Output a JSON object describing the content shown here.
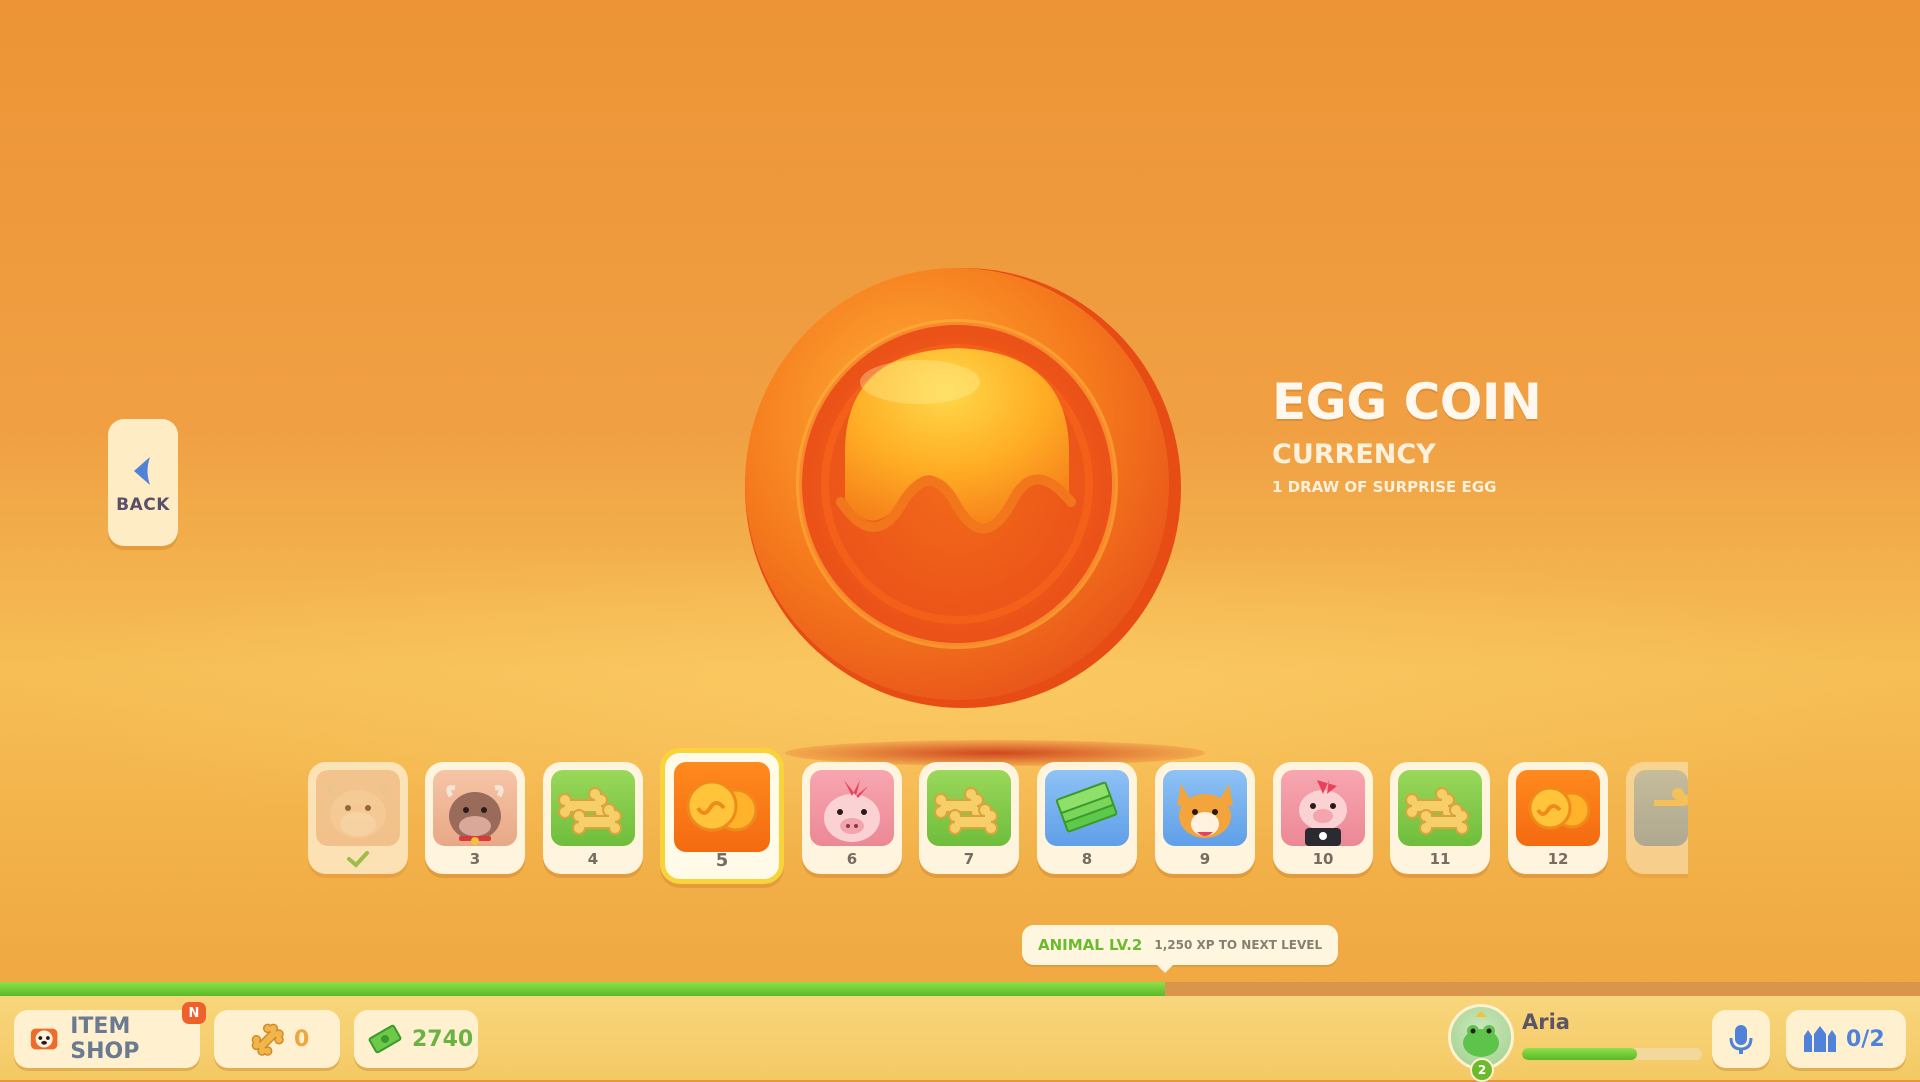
{
  "back_button": {
    "label": "BACK"
  },
  "item": {
    "name": "EGG COIN",
    "type": "CURRENCY",
    "description": "1 DRAW OF SURPRISE EGG"
  },
  "reward_track": {
    "selected_level": 5,
    "slots": [
      {
        "label": "",
        "icon": "cow-icon",
        "claimed": true
      },
      {
        "label": "3",
        "icon": "cow-with-bell-icon"
      },
      {
        "label": "4",
        "icon": "bone-biscuits-icon"
      },
      {
        "label": "5",
        "icon": "egg-coins-icon",
        "selected": true
      },
      {
        "label": "6",
        "icon": "pig-mohawk-icon"
      },
      {
        "label": "7",
        "icon": "bone-biscuits-icon"
      },
      {
        "label": "8",
        "icon": "cash-stack-icon"
      },
      {
        "label": "9",
        "icon": "corgi-icon"
      },
      {
        "label": "10",
        "icon": "punk-pig-icon"
      },
      {
        "label": "11",
        "icon": "bone-biscuits-icon"
      },
      {
        "label": "12",
        "icon": "egg-coins-icon"
      },
      {
        "label": "",
        "icon": "bone-biscuits-icon"
      }
    ]
  },
  "level_tooltip": {
    "level_text": "ANIMAL LV.2",
    "xp_text": "1,250 XP TO NEXT LEVEL"
  },
  "xp_progress": 0.607,
  "hud": {
    "item_shop_label": "ITEM SHOP",
    "item_shop_badge": "N",
    "bones_count": "0",
    "cash_count": "2740",
    "player_name": "Aria",
    "player_level": "2",
    "player_progress": 0.64,
    "party_count": "0/2"
  },
  "colors": {
    "background": "#f0a043",
    "accent_green": "#6cbb2f",
    "selected_border": "#f8d43a",
    "label_slate": "#6a7a90"
  }
}
